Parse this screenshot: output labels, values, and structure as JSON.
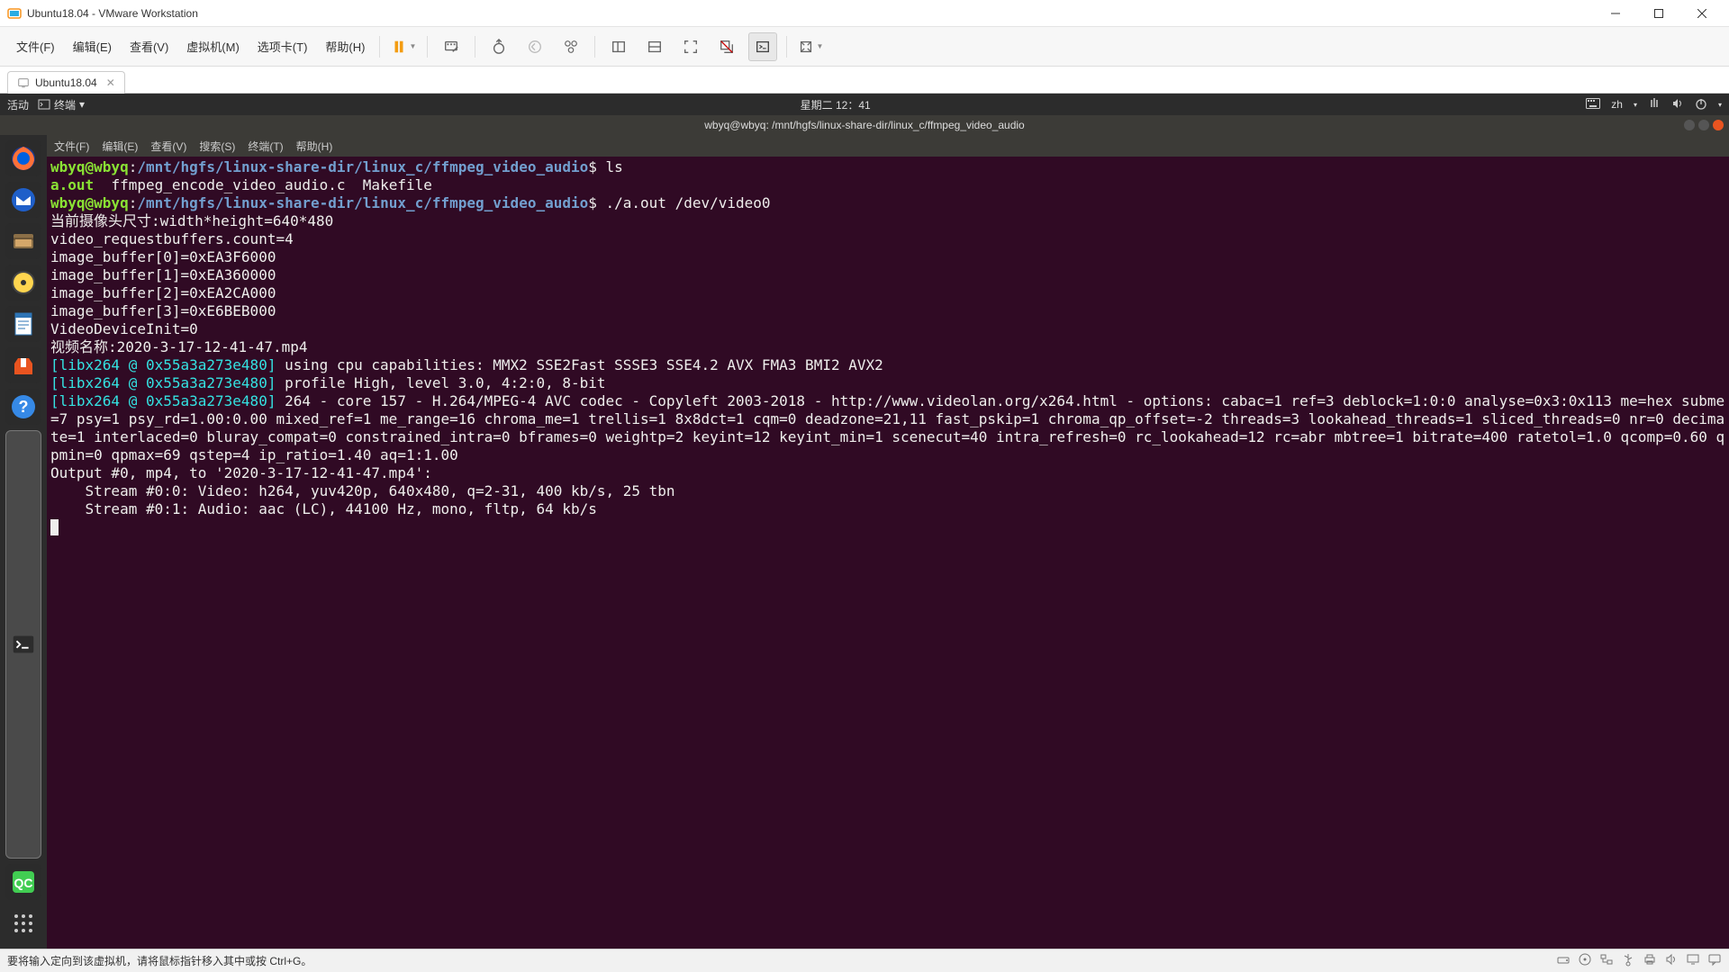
{
  "window": {
    "title": "Ubuntu18.04 - VMware Workstation"
  },
  "menubar": {
    "items": [
      "文件(F)",
      "编辑(E)",
      "查看(V)",
      "虚拟机(M)",
      "选项卡(T)",
      "帮助(H)"
    ]
  },
  "tab": {
    "label": "Ubuntu18.04"
  },
  "ubuntu": {
    "activities": "活动",
    "terminal_indicator": "终端",
    "clock": "星期二 12：41",
    "lang": "zh",
    "term_title": "wbyq@wbyq: /mnt/hgfs/linux-share-dir/linux_c/ffmpeg_video_audio",
    "term_menu": [
      "文件(F)",
      "编辑(E)",
      "查看(V)",
      "搜索(S)",
      "终端(T)",
      "帮助(H)"
    ]
  },
  "prompt": {
    "user": "wbyq@wbyq",
    "path": "/mnt/hgfs/linux-share-dir/linux_c/ffmpeg_video_audio",
    "cmd1": "ls",
    "ls_aout": "a.out",
    "ls_src": "ffmpeg_encode_video_audio.c",
    "ls_make": "Makefile",
    "cmd2": "./a.out /dev/video0"
  },
  "output": {
    "l1": "当前摄像头尺寸:width*height=640*480",
    "l2": "video_requestbuffers.count=4",
    "l3": "image_buffer[0]=0xEA3F6000",
    "l4": "image_buffer[1]=0xEA360000",
    "l5": "image_buffer[2]=0xEA2CA000",
    "l6": "image_buffer[3]=0xE6BEB000",
    "l7": "VideoDeviceInit=0",
    "l8": "视频名称:2020-3-17-12-41-47.mp4",
    "tag": "[libx264 @ 0x55a3a273e480]",
    "x1": " using cpu capabilities: MMX2 SSE2Fast SSSE3 SSE4.2 AVX FMA3 BMI2 AVX2",
    "x2": " profile High, level 3.0, 4:2:0, 8-bit",
    "x3": " 264 - core 157 - H.264/MPEG-4 AVC codec - Copyleft 2003-2018 - http://www.videolan.org/x264.html - options: cabac=1 ref=3 deblock=1:0:0 analyse=0x3:0x113 me=hex subme=7 psy=1 psy_rd=1.00:0.00 mixed_ref=1 me_range=16 chroma_me=1 trellis=1 8x8dct=1 cqm=0 deadzone=21,11 fast_pskip=1 chroma_qp_offset=-2 threads=3 lookahead_threads=1 sliced_threads=0 nr=0 decimate=1 interlaced=0 bluray_compat=0 constrained_intra=0 bframes=0 weightp=2 keyint=12 keyint_min=1 scenecut=40 intra_refresh=0 rc_lookahead=12 rc=abr mbtree=1 bitrate=400 ratetol=1.0 qcomp=0.60 qpmin=0 qpmax=69 qstep=4 ip_ratio=1.40 aq=1:1.00",
    "o1": "Output #0, mp4, to '2020-3-17-12-41-47.mp4':",
    "o2": "    Stream #0:0: Video: h264, yuv420p, 640x480, q=2-31, 400 kb/s, 25 tbn",
    "o3": "    Stream #0:1: Audio: aac (LC), 44100 Hz, mono, fltp, 64 kb/s"
  },
  "statusbar": {
    "text": "要将输入定向到该虚拟机，请将鼠标指针移入其中或按 Ctrl+G。"
  }
}
